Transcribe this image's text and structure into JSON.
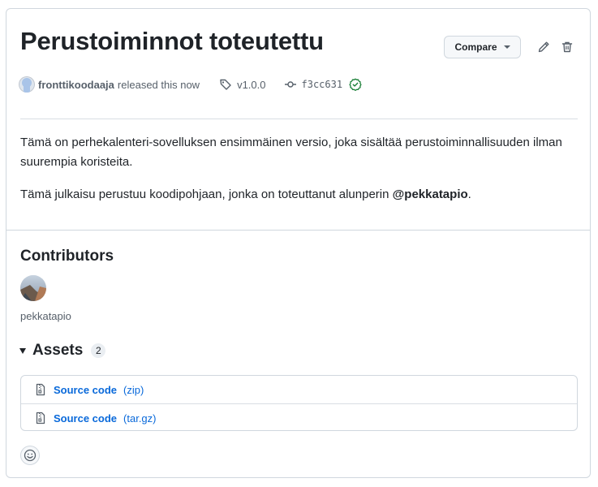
{
  "release": {
    "title": "Perustoiminnot toteutettu",
    "compare_label": "Compare",
    "author": "fronttikoodaaja",
    "released_text": "released this now",
    "tag": "v1.0.0",
    "commit": "f3cc631"
  },
  "body": {
    "paragraph1": "Tämä on perhekalenteri-sovelluksen ensimmäinen versio, joka sisältää perustoiminnallisuuden ilman suurempia koristeita.",
    "paragraph2_prefix": "Tämä julkaisu perustuu koodipohjaan, jonka on toteuttanut alunperin ",
    "paragraph2_mention": "@pekkatapio",
    "paragraph2_suffix": "."
  },
  "contributors": {
    "heading": "Contributors",
    "items": [
      {
        "name": "pekkatapio"
      }
    ]
  },
  "assets": {
    "heading": "Assets",
    "count": "2",
    "items": [
      {
        "name": "Source code",
        "ext": "(zip)"
      },
      {
        "name": "Source code",
        "ext": "(tar.gz)"
      }
    ]
  },
  "icons": {
    "edit": "pencil-icon",
    "delete": "trash-icon",
    "tag": "tag-icon",
    "commit": "git-commit-icon",
    "verified": "check-circle-icon",
    "archive": "file-zip-icon",
    "reaction": "smiley-icon"
  },
  "colors": {
    "link": "#0969da",
    "verified": "#1a7f37",
    "border": "#d0d7de",
    "muted": "#57606a"
  }
}
